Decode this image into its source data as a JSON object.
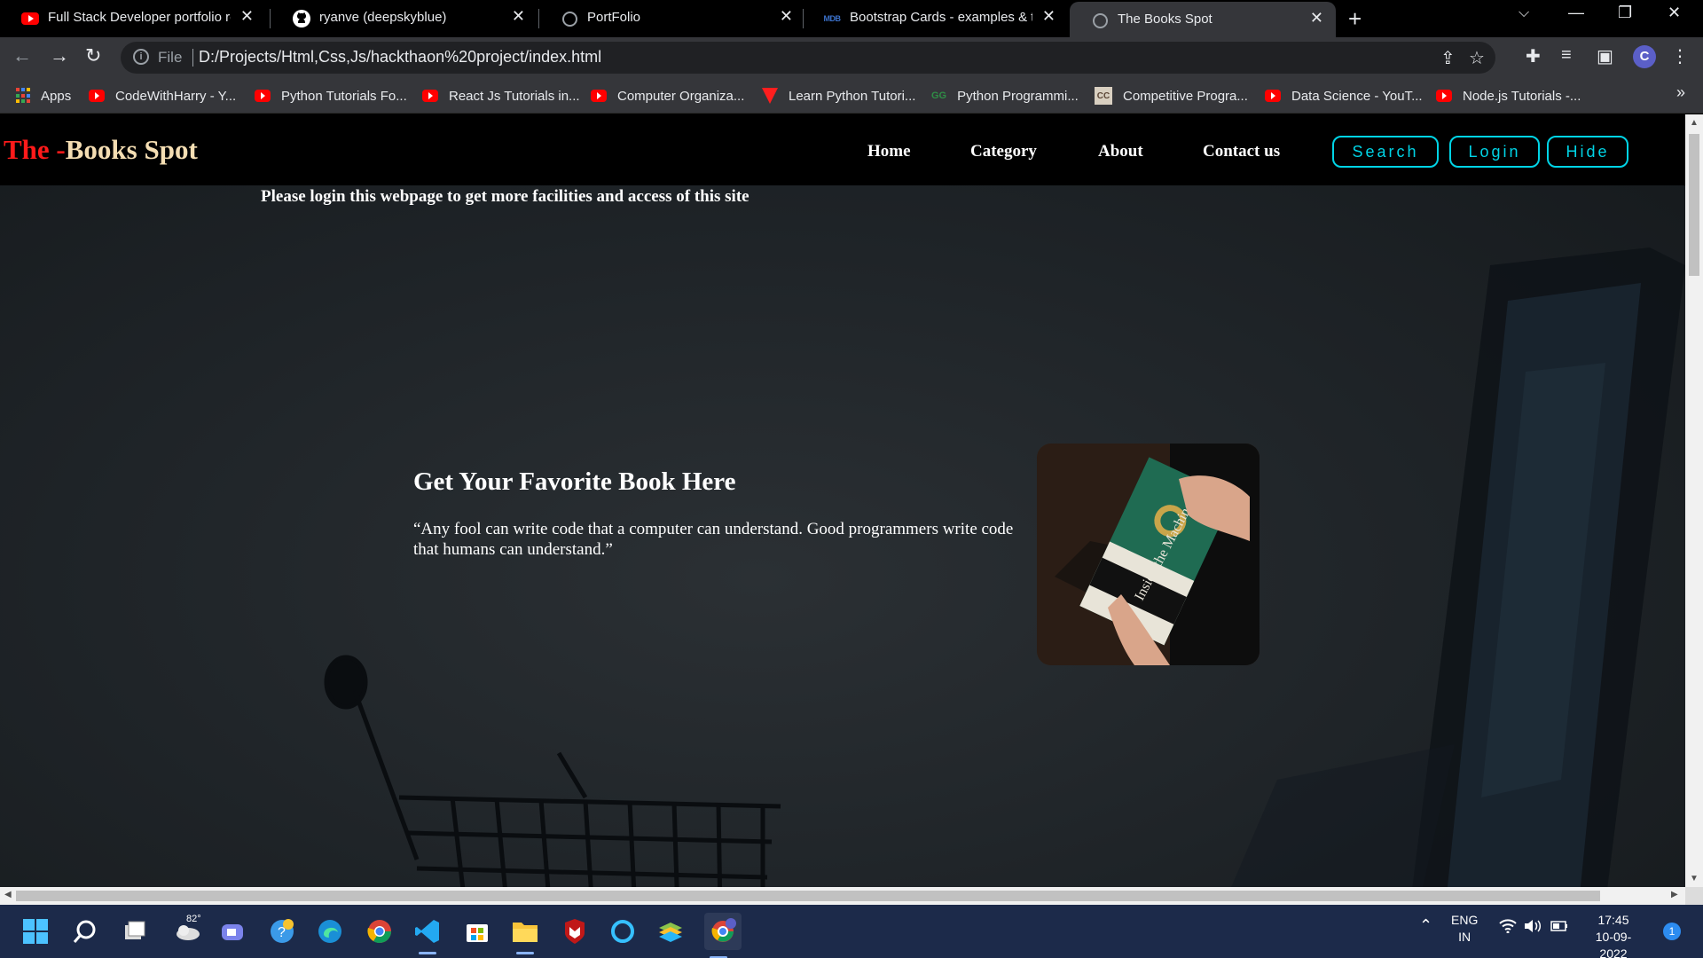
{
  "browser": {
    "tabs": [
      {
        "title": "Full Stack Developer portfolio rev",
        "icon": "youtube-icon"
      },
      {
        "title": "ryanve (deepskyblue)",
        "icon": "github-icon"
      },
      {
        "title": "PortFolio",
        "icon": "globe-icon"
      },
      {
        "title": "Bootstrap Cards - examples & tu",
        "icon": "mdb-icon",
        "icon_text": "MDB"
      },
      {
        "title": "The Books Spot",
        "icon": "globe-icon",
        "active": true
      }
    ],
    "address": {
      "scheme_label": "File",
      "url": "D:/Projects/Html,Css,Js/hackthaon%20project/index.html"
    },
    "bookmarks": [
      {
        "label": "Apps",
        "icon": "apps-grid-icon"
      },
      {
        "label": "CodeWithHarry - Y...",
        "icon": "youtube-icon"
      },
      {
        "label": "Python Tutorials Fo...",
        "icon": "youtube-icon"
      },
      {
        "label": "React Js Tutorials in...",
        "icon": "youtube-icon"
      },
      {
        "label": "Computer Organiza...",
        "icon": "youtube-icon"
      },
      {
        "label": "Learn Python Tutori...",
        "icon": "red-triangle-icon"
      },
      {
        "label": "Python Programmi...",
        "icon": "gfg-icon",
        "icon_text": "GG"
      },
      {
        "label": "Competitive Progra...",
        "icon": "cc-icon",
        "icon_text": "CC"
      },
      {
        "label": "Data Science - YouT...",
        "icon": "youtube-icon"
      },
      {
        "label": "Node.js Tutorials -...",
        "icon": "youtube-icon"
      }
    ],
    "bookmarks_more": "»"
  },
  "site": {
    "brand_part1": "The -",
    "brand_part2": "Books Spot",
    "nav": [
      "Home",
      "Category",
      "About",
      "Contact us"
    ],
    "buttons": [
      "Search",
      "Login",
      "Hide"
    ],
    "notice": "Please login this webpage to get more facilities and access of this site",
    "hero": {
      "title": "Get Your Favorite Book Here",
      "quote": "“Any fool can write code that a computer can understand. Good programmers write code that humans can understand.”"
    },
    "book_image": {
      "alt": "Inside the Machine book cover",
      "cover_text": "Inside the Machine"
    }
  },
  "taskbar": {
    "weather": "82°",
    "lang_line1": "ENG",
    "lang_line2": "IN",
    "time": "17:45",
    "date": "10-09-2022",
    "notifications": "1",
    "colors": {
      "taskbar_bg": "#1c2a4a",
      "accent": "#00d4e6",
      "brand_red": "#ff1a1a",
      "brand_tan": "#f5deb3"
    }
  }
}
